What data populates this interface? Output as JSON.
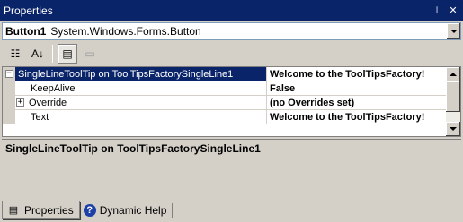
{
  "window": {
    "title": "Properties",
    "pin_glyph": "⊥",
    "close_glyph": "✕"
  },
  "selector": {
    "object_name": "Button1",
    "object_type": "System.Windows.Forms.Button"
  },
  "toolbar": {
    "buttons": [
      {
        "name": "categorized",
        "icon": "categorized-icon",
        "glyph": "☷",
        "pressed": false
      },
      {
        "name": "alphabetical",
        "icon": "sort-az-icon",
        "glyph": "A↓",
        "pressed": false
      },
      {
        "name": "properties",
        "icon": "properties-icon",
        "glyph": "▤",
        "pressed": true
      },
      {
        "name": "property-pages",
        "icon": "property-pages-icon",
        "glyph": "▭",
        "pressed": false,
        "disabled": true
      }
    ]
  },
  "grid": {
    "rows": [
      {
        "name": "SingleLineToolTip on ToolTipsFactorySingleLine1",
        "value": "Welcome to the ToolTipsFactory!",
        "expander": "⊟"
      },
      {
        "name": "KeepAlive",
        "value": "False"
      },
      {
        "name": "Override",
        "value": "(no Overrides set)",
        "expander": "+"
      },
      {
        "name": "Text",
        "value": "Welcome to the ToolTipsFactory!"
      }
    ]
  },
  "description": {
    "title": "SingleLineToolTip on ToolTipsFactorySingleLine1"
  },
  "tabs": [
    {
      "label": "Properties",
      "icon": "properties-tab-icon",
      "active": true
    },
    {
      "label": "Dynamic Help",
      "icon": "help-icon",
      "active": false
    }
  ],
  "colors": {
    "titlebar": "#0a246a",
    "selection": "#0a246a",
    "chrome": "#d4d0c8"
  }
}
